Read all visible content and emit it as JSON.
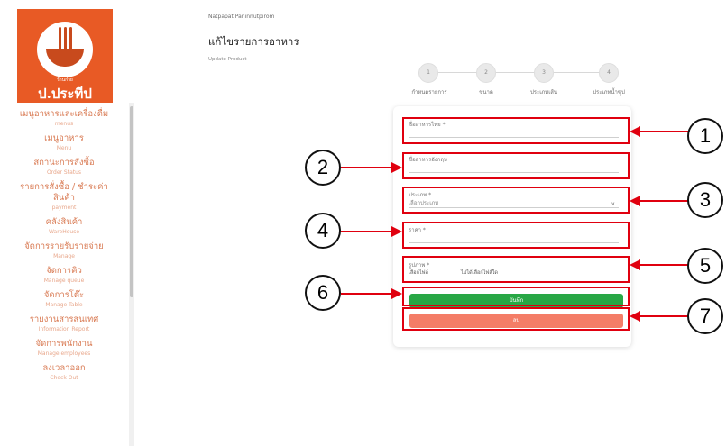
{
  "brand": {
    "logo_small": "ร้านก๋วย",
    "logo_text": "ป.ประทีป"
  },
  "sidebar": {
    "items": [
      {
        "th": "เมนูอาหารและเครื่องดื่ม",
        "en": "menus"
      },
      {
        "th": "เมนูอาหาร",
        "en": "Menu"
      },
      {
        "th": "สถานะการสั่งซื้อ",
        "en": "Order Status"
      },
      {
        "th": "รายการสั่งซื้อ / ชำระค่าสินค้า",
        "en": "payment"
      },
      {
        "th": "คลังสินค้า",
        "en": "WareHouse"
      },
      {
        "th": "จัดการรายรับรายจ่าย",
        "en": "Manage"
      },
      {
        "th": "จัดการคิว",
        "en": "Manage queue"
      },
      {
        "th": "จัดการโต๊ะ",
        "en": "Manage Table"
      },
      {
        "th": "รายงานสารสนเทศ",
        "en": "Information Report"
      },
      {
        "th": "จัดการพนักงาน",
        "en": "Manage employees"
      },
      {
        "th": "ลงเวลาออก",
        "en": "Check Out"
      }
    ]
  },
  "header": {
    "user": "Natpapat Paninnutpirom",
    "title": "แก้ไขรายการอาหาร",
    "subtitle": "Update Product"
  },
  "steps": [
    {
      "num": "1",
      "label": "กำหนดรายการ"
    },
    {
      "num": "2",
      "label": "ขนาด"
    },
    {
      "num": "3",
      "label": "ประเภทเส้น"
    },
    {
      "num": "4",
      "label": "ประเภทน้ำซุป"
    }
  ],
  "form": {
    "name_th_label": "ชื่ออาหารไทย *",
    "name_en_label": "ชื่ออาหารอังกฤษ",
    "type_label": "ประเภท *",
    "type_value": "เลือกประเภท",
    "price_label": "ราคา *",
    "image_label": "รูปภาพ *",
    "file_button": "เลือกไฟล์",
    "file_none": "ไม่ได้เลือกไฟล์ใด",
    "save_label": "บันทึก",
    "delete_label": "ลบ"
  },
  "annotations": [
    "1",
    "2",
    "3",
    "4",
    "5",
    "6",
    "7"
  ],
  "colors": {
    "brand": "#e85a25",
    "save": "#28a745",
    "delete": "#f47d67",
    "annotation": "#e0000f"
  }
}
